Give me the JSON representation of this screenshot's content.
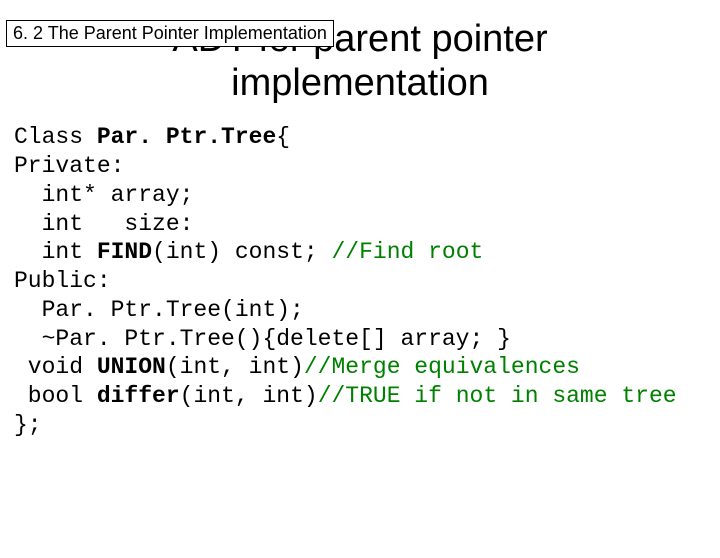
{
  "section_label": "6. 2 The Parent Pointer Implementation",
  "title_line1": "ADT for parent pointer",
  "title_line2": "implementation",
  "code": {
    "l1a": "Class ",
    "l1b": "Par. Ptr.Tree",
    "l1c": "{",
    "l2": "Private:",
    "l3": "  int* array;",
    "l4": "  int   size:",
    "l5a": "  int ",
    "l5b": "FIND",
    "l5c": "(int) const; ",
    "l5d": "//Find root",
    "l6": "Public:",
    "l7": "  Par. Ptr.Tree(int);",
    "l8": "  ~Par. Ptr.Tree(){delete[] array; }",
    "l9a": " void ",
    "l9b": "UNION",
    "l9c": "(int, int)",
    "l9d": "//Merge equivalences",
    "l10a": " bool ",
    "l10b": "differ",
    "l10c": "(int, int)",
    "l10d": "//TRUE if not in same tree",
    "l11": "};"
  }
}
